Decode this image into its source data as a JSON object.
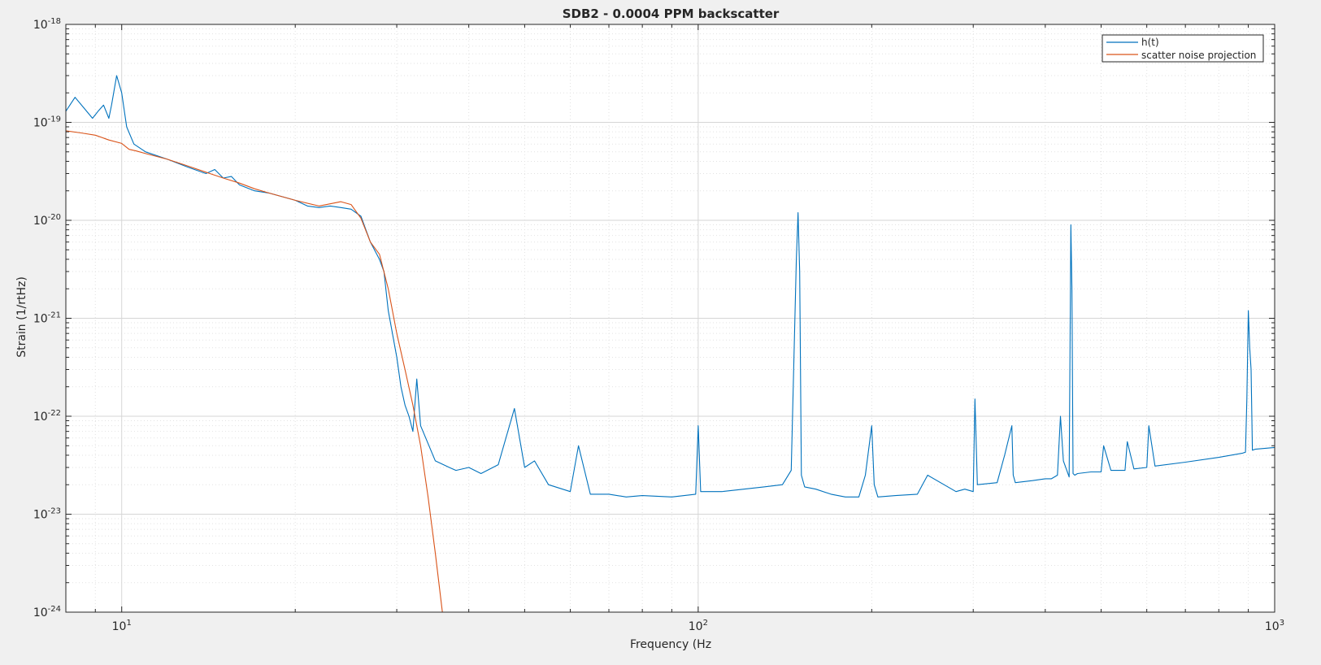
{
  "chart_data": {
    "type": "line",
    "title": "SDB2 - 0.0004 PPM backscatter",
    "xlabel": "Frequency (Hz",
    "ylabel": "Strain (1/rtHz)",
    "x_scale": "log",
    "y_scale": "log",
    "xlim": [
      8,
      1000
    ],
    "ylim": [
      1e-24,
      1e-18
    ],
    "grid": true,
    "minor_grid": true,
    "legend": "top-right",
    "x_ticks": [
      {
        "value": 10,
        "base": "10",
        "exp": "1"
      },
      {
        "value": 100,
        "base": "10",
        "exp": "2"
      },
      {
        "value": 1000,
        "base": "10",
        "exp": "3"
      }
    ],
    "y_ticks": [
      {
        "value": 1e-24,
        "base": "10",
        "exp": "-24"
      },
      {
        "value": 1e-23,
        "base": "10",
        "exp": "-23"
      },
      {
        "value": 1e-22,
        "base": "10",
        "exp": "-22"
      },
      {
        "value": 1e-21,
        "base": "10",
        "exp": "-21"
      },
      {
        "value": 1e-20,
        "base": "10",
        "exp": "-20"
      },
      {
        "value": 1e-19,
        "base": "10",
        "exp": "-19"
      },
      {
        "value": 1e-18,
        "base": "10",
        "exp": "-18"
      }
    ],
    "series": [
      {
        "name": "h(t)",
        "color": "#0072BD",
        "x": [
          8,
          8.3,
          8.6,
          8.9,
          9.1,
          9.3,
          9.5,
          9.6,
          9.8,
          10.0,
          10.2,
          10.5,
          11,
          12,
          13,
          14,
          14.5,
          15,
          15.5,
          16,
          17,
          18,
          20,
          21,
          22,
          23,
          24,
          25,
          26,
          27,
          28,
          28.5,
          29,
          30,
          30.5,
          31,
          31.5,
          32,
          32.5,
          33,
          35,
          37,
          38,
          40,
          42,
          45,
          48,
          50,
          52,
          55,
          60,
          62,
          65,
          70,
          75,
          80,
          90,
          99,
          100,
          101,
          110,
          120,
          130,
          140,
          145,
          148,
          149,
          150,
          151,
          153,
          160,
          170,
          180,
          190,
          195,
          200,
          202,
          205,
          220,
          240,
          250,
          280,
          290,
          300,
          302,
          305,
          330,
          340,
          350,
          352,
          355,
          380,
          400,
          410,
          420,
          425,
          430,
          440,
          443,
          445,
          447,
          450,
          455,
          480,
          500,
          505,
          520,
          550,
          555,
          570,
          600,
          605,
          620,
          700,
          800,
          880,
          890,
          895,
          900,
          905,
          910,
          915,
          925,
          1000
        ],
        "y": [
          1.3e-19,
          1.8e-19,
          1.4e-19,
          1.1e-19,
          1.3e-19,
          1.5e-19,
          1.1e-19,
          1.5e-19,
          3e-19,
          2e-19,
          9e-20,
          6e-20,
          5e-20,
          4.2e-20,
          3.5e-20,
          3e-20,
          3.3e-20,
          2.7e-20,
          2.8e-20,
          2.3e-20,
          2e-20,
          1.9e-20,
          1.6e-20,
          1.4e-20,
          1.35e-20,
          1.4e-20,
          1.35e-20,
          1.3e-20,
          1.1e-20,
          6e-21,
          4e-21,
          3e-21,
          1.2e-21,
          4e-22,
          2e-22,
          1.3e-22,
          1e-22,
          7e-23,
          2.4e-22,
          8e-23,
          3.5e-23,
          3e-23,
          2.8e-23,
          3e-23,
          2.6e-23,
          3.2e-23,
          1.2e-22,
          3e-23,
          3.5e-23,
          2e-23,
          1.7e-23,
          5e-23,
          1.6e-23,
          1.6e-23,
          1.5e-23,
          1.55e-23,
          1.5e-23,
          1.6e-23,
          8e-23,
          1.7e-23,
          1.7e-23,
          1.8e-23,
          1.9e-23,
          2e-23,
          2.8e-23,
          4e-21,
          1.2e-20,
          3e-21,
          2.5e-23,
          1.9e-23,
          1.8e-23,
          1.6e-23,
          1.5e-23,
          1.5e-23,
          2.5e-23,
          8e-23,
          2e-23,
          1.5e-23,
          1.55e-23,
          1.6e-23,
          2.5e-23,
          1.7e-23,
          1.8e-23,
          1.7e-23,
          1.5e-22,
          2e-23,
          2.1e-23,
          4e-23,
          8e-23,
          2.5e-23,
          2.1e-23,
          2.2e-23,
          2.3e-23,
          2.3e-23,
          2.5e-23,
          1e-22,
          3.5e-23,
          2.4e-23,
          9e-21,
          2e-21,
          2.6e-23,
          2.5e-23,
          2.6e-23,
          2.7e-23,
          2.7e-23,
          5e-23,
          2.8e-23,
          2.8e-23,
          5.5e-23,
          2.9e-23,
          3e-23,
          8e-23,
          3.1e-23,
          3.4e-23,
          3.8e-23,
          4.2e-23,
          4.3e-23,
          1.5e-22,
          1.2e-21,
          5e-22,
          3e-22,
          4.5e-23,
          4.6e-23,
          4.8e-23
        ]
      },
      {
        "name": "scatter noise projection",
        "color": "#D95319",
        "x": [
          8,
          8.5,
          9,
          9.5,
          10,
          10.3,
          10.6,
          11,
          12,
          13,
          14,
          15,
          16,
          17,
          18,
          20,
          22,
          24,
          25,
          26,
          27,
          28,
          29,
          30,
          31,
          32,
          33,
          34,
          35,
          36
        ],
        "y": [
          8.2e-20,
          7.8e-20,
          7.4e-20,
          6.6e-20,
          6.1e-20,
          5.3e-20,
          5.1e-20,
          4.8e-20,
          4.2e-20,
          3.6e-20,
          3.1e-20,
          2.7e-20,
          2.4e-20,
          2.1e-20,
          1.9e-20,
          1.6e-20,
          1.4e-20,
          1.55e-20,
          1.45e-20,
          1.05e-20,
          6e-21,
          4.5e-21,
          2e-21,
          7e-22,
          3e-22,
          1.3e-22,
          5e-23,
          1.5e-23,
          4e-24,
          1e-24
        ]
      }
    ]
  }
}
